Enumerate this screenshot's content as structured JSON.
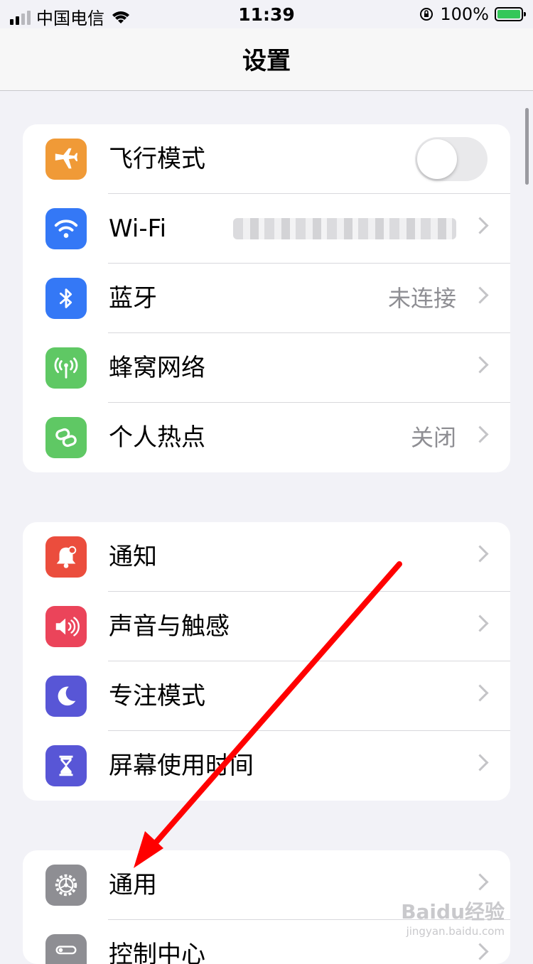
{
  "status_bar": {
    "carrier": "中国电信",
    "time": "11:39",
    "battery_percent": "100%"
  },
  "nav": {
    "title": "设置"
  },
  "groups": [
    {
      "rows": [
        {
          "label": "飞行模式",
          "icon": "airplane-icon",
          "icon_color": "#f09a37",
          "toggle_on": false
        },
        {
          "label": "Wi-Fi",
          "icon": "wifi-icon",
          "icon_color": "#3478f6"
        },
        {
          "label": "蓝牙",
          "icon": "bluetooth-icon",
          "icon_color": "#3478f6",
          "value": "未连接"
        },
        {
          "label": "蜂窝网络",
          "icon": "antenna-icon",
          "icon_color": "#5fc864"
        },
        {
          "label": "个人热点",
          "icon": "hotspot-icon",
          "icon_color": "#5fc864",
          "value": "关闭"
        }
      ]
    },
    {
      "rows": [
        {
          "label": "通知",
          "icon": "bell-icon",
          "icon_color": "#eb4d3d"
        },
        {
          "label": "声音与触感",
          "icon": "speaker-icon",
          "icon_color": "#eb445a"
        },
        {
          "label": "专注模式",
          "icon": "moon-icon",
          "icon_color": "#5856d6"
        },
        {
          "label": "屏幕使用时间",
          "icon": "hourglass-icon",
          "icon_color": "#5856d6"
        }
      ]
    },
    {
      "rows": [
        {
          "label": "通用",
          "icon": "gear-icon",
          "icon_color": "#8e8e93"
        },
        {
          "label": "控制中心",
          "icon": "toggles-icon",
          "icon_color": "#8e8e93"
        }
      ]
    }
  ],
  "annotation": {
    "arrow_color": "#ff0000"
  },
  "watermark": {
    "text": "Baidu经验",
    "sub": "jingyan.baidu.com"
  }
}
